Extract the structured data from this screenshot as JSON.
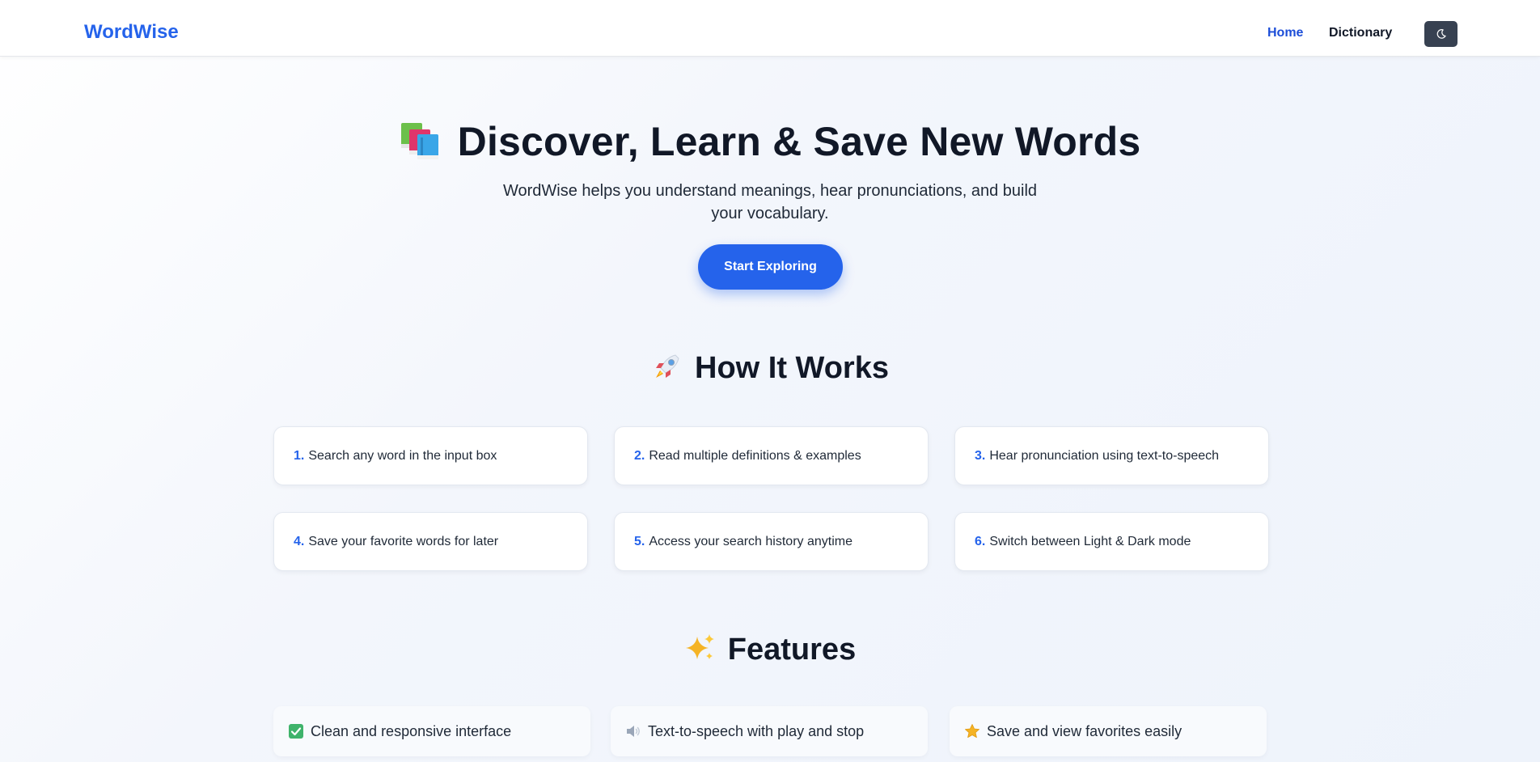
{
  "header": {
    "brand": "WordWise",
    "nav": [
      {
        "label": "Home",
        "active": true
      },
      {
        "label": "Dictionary",
        "active": false
      }
    ],
    "theme_toggle_icon": "moon-icon"
  },
  "hero": {
    "icon": "books-icon",
    "title": "Discover, Learn & Save New Words",
    "subtitle": "WordWise helps you understand meanings, hear pronunciations, and build your vocabulary.",
    "cta_label": "Start Exploring"
  },
  "how_it_works": {
    "icon": "rocket-icon",
    "title": "How It Works",
    "steps": [
      {
        "num": "1.",
        "text": "Search any word in the input box"
      },
      {
        "num": "2.",
        "text": "Read multiple definitions & examples"
      },
      {
        "num": "3.",
        "text": "Hear pronunciation using text-to-speech"
      },
      {
        "num": "4.",
        "text": "Save your favorite words for later"
      },
      {
        "num": "5.",
        "text": "Access your search history anytime"
      },
      {
        "num": "6.",
        "text": "Switch between Light & Dark mode"
      }
    ]
  },
  "features": {
    "icon": "sparkles-icon",
    "title": "Features",
    "items": [
      {
        "icon": "check-mark-icon",
        "text": "Clean and responsive interface"
      },
      {
        "icon": "speaker-icon",
        "text": "Text-to-speech with play and stop"
      },
      {
        "icon": "star-icon",
        "text": "Save and view favorites easily"
      }
    ]
  },
  "colors": {
    "accent": "#2563eb",
    "toggle_bg": "#374151",
    "text": "#111827"
  }
}
